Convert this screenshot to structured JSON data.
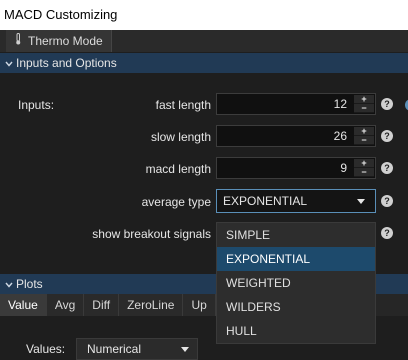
{
  "window": {
    "title": "MACD Customizing"
  },
  "toolbar": {
    "thermo_label": "Thermo Mode",
    "thermo_icon": "thermometer-icon"
  },
  "inputs_section": {
    "title": "Inputs and Options",
    "inputs_label": "Inputs:",
    "fields": [
      {
        "label": "fast length",
        "value": "12"
      },
      {
        "label": "slow length",
        "value": "26"
      },
      {
        "label": "macd length",
        "value": "9"
      }
    ],
    "average_type": {
      "label": "average type",
      "value": "EXPONENTIAL",
      "options": [
        "SIMPLE",
        "EXPONENTIAL",
        "WEIGHTED",
        "WILDERS",
        "HULL"
      ]
    },
    "breakout_label": "show breakout signals"
  },
  "plots_section": {
    "title": "Plots",
    "tabs": [
      "Value",
      "Avg",
      "Diff",
      "ZeroLine",
      "Up"
    ],
    "values_label": "Values:",
    "values_value": "Numerical"
  },
  "colors": {
    "header_bg": "#213a55",
    "selected_option": "#1d4a6c",
    "focus_border": "#5a8fb8"
  }
}
